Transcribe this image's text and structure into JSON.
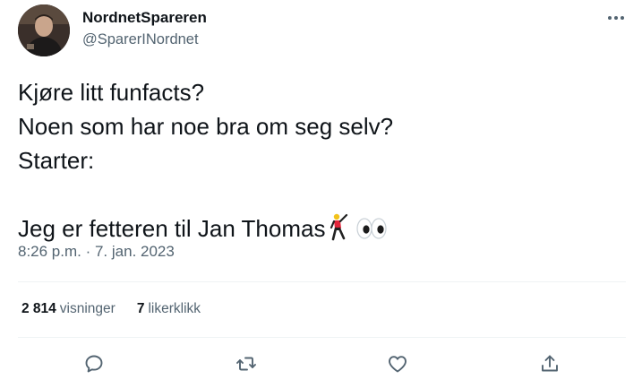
{
  "author": {
    "display_name": "NordnetSpareren",
    "handle": "@SparerINordnet"
  },
  "tweet": {
    "lines": [
      "Kjøre litt funfacts?",
      "Noen som har noe bra om seg selv?",
      "Starter:",
      "",
      "Jeg er fetteren til Jan Thomas"
    ],
    "emojis": [
      "man-dancing-icon",
      "eyes-icon"
    ],
    "timestamp": "8:26 p.m. · 7. jan. 2023"
  },
  "stats": {
    "views_count": "2 814",
    "views_label": "visninger",
    "likes_count": "7",
    "likes_label": "likerklikk"
  },
  "actions": [
    "reply-icon",
    "retweet-icon",
    "like-icon",
    "share-icon"
  ],
  "colors": {
    "text": "#0f1419",
    "secondary": "#536471",
    "divider": "#eff3f4"
  }
}
